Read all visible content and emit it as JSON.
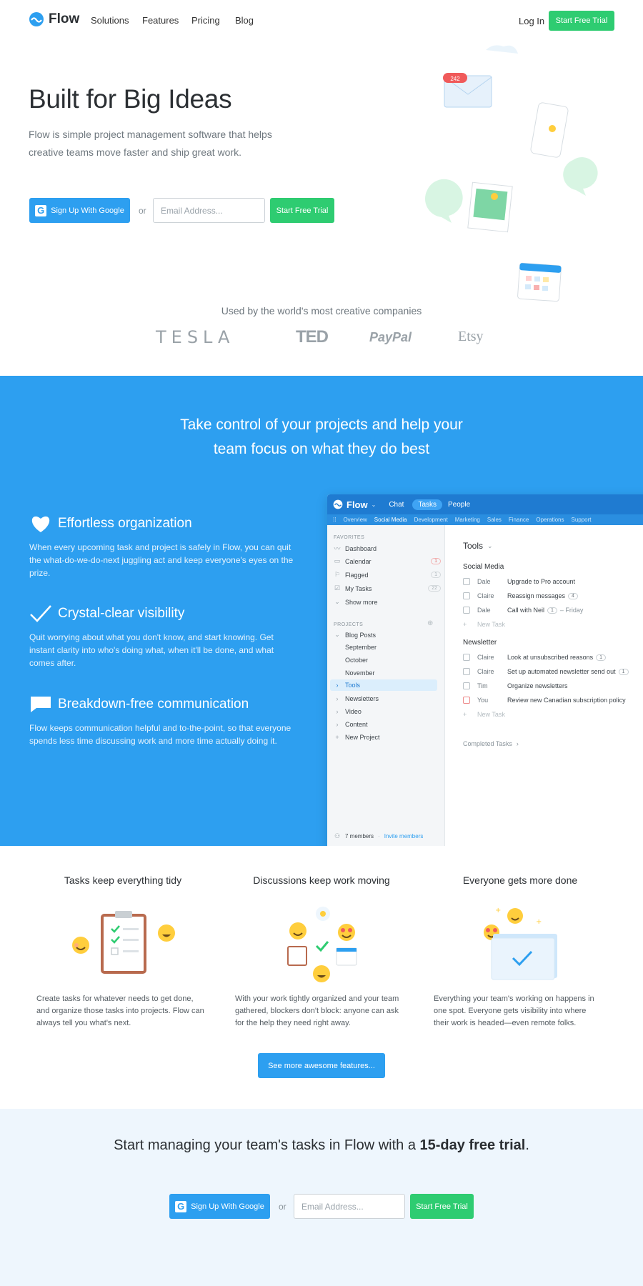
{
  "nav": {
    "logo_text": "Flow",
    "links": [
      "Solutions",
      "Features",
      "Pricing",
      "Blog"
    ],
    "login": "Log In",
    "cta": "Start Free Trial"
  },
  "hero": {
    "title": "Built for Big Ideas",
    "subtitle": "Flow is simple project management software that helps creative teams move faster and ship great work.",
    "google_button": "Sign Up With Google",
    "or": "or",
    "email_placeholder": "Email Address...",
    "trial_button": "Start Free Trial",
    "badge_count": "242"
  },
  "used_by": {
    "text": "Used by the world's most creative companies",
    "brands": [
      "TESLA",
      "TED",
      "PayPal",
      "Etsy"
    ]
  },
  "blue": {
    "heading_line1": "Take control of your projects and help your",
    "heading_line2": "team focus on what they do best",
    "features": [
      {
        "title": "Effortless organization",
        "icon": "heart-icon",
        "body": "When every upcoming task and project is safely in Flow, you can quit the what-do-we-do-next juggling act and keep everyone's eyes on the prize."
      },
      {
        "title": "Crystal-clear visibility",
        "icon": "check-icon",
        "body": "Quit worrying about what you don't know, and start knowing. Get instant clarity into who's doing what, when it'll be done, and what comes after."
      },
      {
        "title": "Breakdown-free communication",
        "icon": "chat-bubble-icon",
        "body": "Flow keeps communication helpful and to-the-point, so that everyone spends less time discussing work and more time actually doing it."
      }
    ]
  },
  "app": {
    "brand": "Flow",
    "tabs": [
      "Chat",
      "Tasks",
      "People"
    ],
    "subtabs": [
      "Overview",
      "Social Media",
      "Development",
      "Marketing",
      "Sales",
      "Finance",
      "Operations",
      "Support"
    ],
    "favorites_header": "FAVORITES",
    "favorites": [
      {
        "label": "Dashboard",
        "count": ""
      },
      {
        "label": "Calendar",
        "count": "1"
      },
      {
        "label": "Flagged",
        "count": "1"
      },
      {
        "label": "My Tasks",
        "count": "22"
      },
      {
        "label": "Show more",
        "count": ""
      }
    ],
    "projects_header": "PROJECTS",
    "projects": [
      "Blog Posts",
      "September",
      "October",
      "November",
      "Tools",
      "Newsletters",
      "Video",
      "Content",
      "New Project"
    ],
    "members": "7 members",
    "invite": "Invite members",
    "list_title": "Tools",
    "section1": "Social Media",
    "tasks1": [
      {
        "who": "Dale",
        "task": "Upgrade to Pro account",
        "count": ""
      },
      {
        "who": "Claire",
        "task": "Reassign messages",
        "count": "4"
      },
      {
        "who": "Dale",
        "task": "Call with Neil",
        "count": "1",
        "due": "– Friday"
      }
    ],
    "new_task": "New Task",
    "section2": "Newsletter",
    "tasks2": [
      {
        "who": "Claire",
        "task": "Look at unsubscribed reasons",
        "count": "1"
      },
      {
        "who": "Claire",
        "task": "Set up automated newsletter send out",
        "count": "1"
      },
      {
        "who": "Tim",
        "task": "Organize newsletters",
        "count": ""
      },
      {
        "who": "You",
        "task": "Review new Canadian subscription policy",
        "count": ""
      }
    ],
    "completed": "Completed Tasks"
  },
  "columns": [
    {
      "title": "Tasks keep everything tidy",
      "body": "Create tasks for whatever needs to get done, and organize those tasks into projects. Flow can always tell you what's next."
    },
    {
      "title": "Discussions keep work moving",
      "body": "With your work tightly organized and your team gathered, blockers don't block: anyone can ask for the help they need right away."
    },
    {
      "title": "Everyone gets more done",
      "body": "Everything your team's working on happens in one spot. Everyone gets visibility into where their work is headed—even remote folks."
    }
  ],
  "more_button": "See more awesome features...",
  "cta": {
    "title_pre": "Start managing your team's tasks in Flow with a ",
    "title_bold": "15-day free trial",
    "title_post": ".",
    "google_button": "Sign Up With Google",
    "or": "or",
    "email_placeholder": "Email Address...",
    "trial_button": "Start Free Trial"
  },
  "colors": {
    "blue": "#2d9ff0",
    "green": "#2ecc71",
    "app_blue": "#1f7bd1"
  }
}
